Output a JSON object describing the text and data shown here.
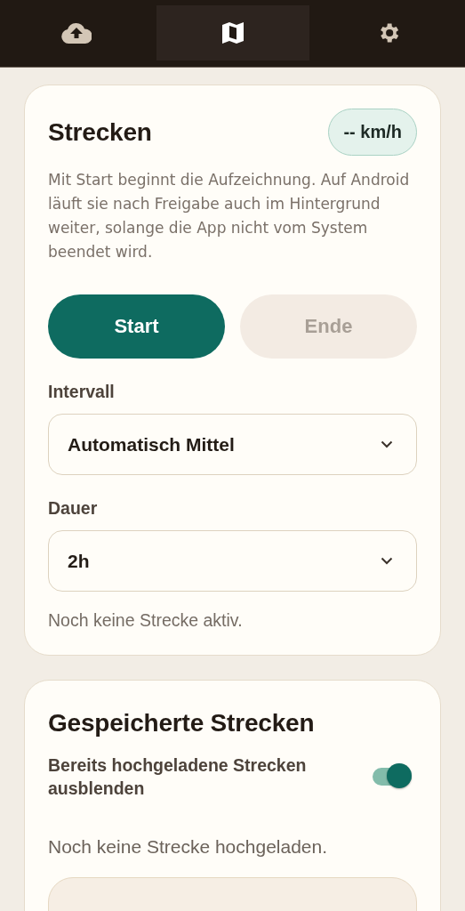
{
  "tabs": [
    {
      "kind": "upload",
      "selected": false
    },
    {
      "kind": "map",
      "selected": true
    },
    {
      "kind": "settings",
      "selected": false
    }
  ],
  "track_card": {
    "title": "Strecken",
    "speed_badge": "-- km/h",
    "description": "Mit Start beginnt die Aufzeichnung. Auf Android läuft sie nach Freigabe auch im Hintergrund weiter, solange die App nicht vom System beendet wird.",
    "buttons": [
      {
        "label": "Start",
        "kind": "primary",
        "disabled": false
      },
      {
        "label": "Ende",
        "kind": "secondary",
        "disabled": true
      }
    ],
    "fields": [
      {
        "label": "Intervall",
        "value": "Automatisch Mittel"
      },
      {
        "label": "Dauer",
        "value": "2h"
      }
    ],
    "status": "Noch keine Strecke aktiv."
  },
  "saved_card": {
    "title": "Gespeicherte Strecken",
    "toggle": {
      "label": "Bereits hochgeladene Strecken ausblenden",
      "on": true
    },
    "empty_text": "Noch keine Strecke hochgeladen."
  }
}
